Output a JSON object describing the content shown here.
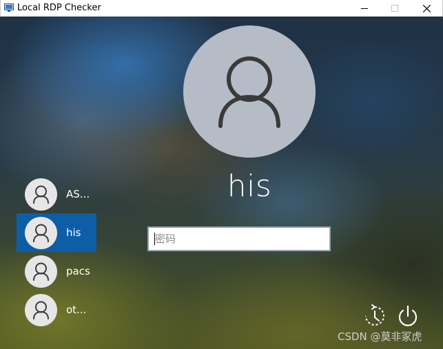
{
  "window": {
    "title": "Local RDP Checker",
    "controls": [
      "minimize",
      "maximize",
      "close"
    ]
  },
  "login": {
    "selected_user": "his",
    "password_placeholder": "密码"
  },
  "users": [
    {
      "label": "AS...",
      "selected": false
    },
    {
      "label": "his",
      "selected": true
    },
    {
      "label": "pacs",
      "selected": false
    },
    {
      "label": "ot...",
      "selected": false
    }
  ],
  "corner": {
    "accessibility_icon": "ease-of-access-icon",
    "power_icon": "power-icon"
  },
  "watermark": "CSDN @莫非冢虎",
  "colors": {
    "selected_user_bg": "#0d5ea6",
    "avatar_bg": "#b5bcc5"
  }
}
